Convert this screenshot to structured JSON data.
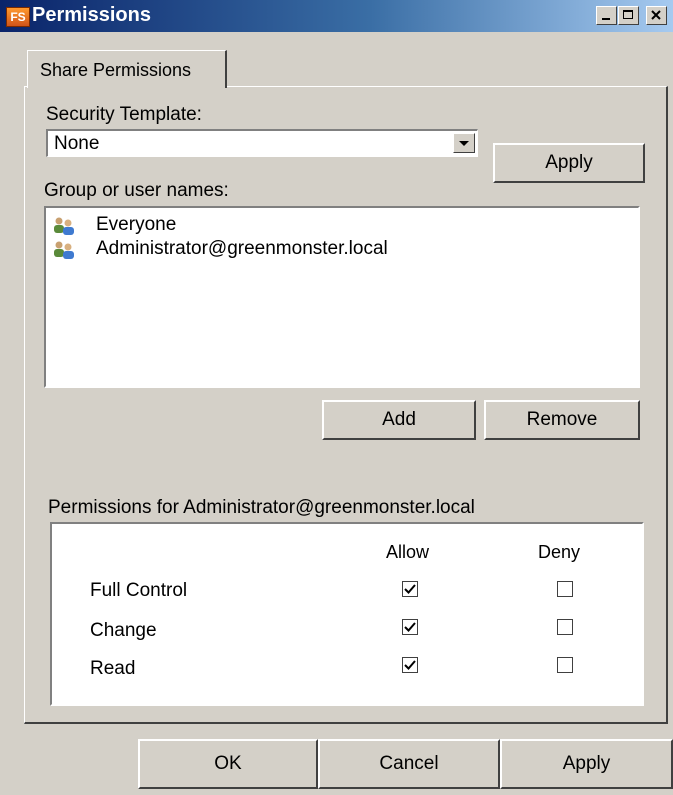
{
  "window": {
    "title": "Permissions",
    "app_icon": "FS"
  },
  "tabs": [
    {
      "label": "Share Permissions",
      "active": true
    }
  ],
  "security_template": {
    "label": "Security Template:",
    "value": "None",
    "apply_label": "Apply"
  },
  "group_list": {
    "label": "Group or user names:",
    "items": [
      {
        "name": "Everyone",
        "icon": "users-icon"
      },
      {
        "name": "Administrator@greenmonster.local",
        "icon": "users-icon"
      }
    ],
    "add_label": "Add",
    "remove_label": "Remove"
  },
  "permissions": {
    "label": "Permissions for Administrator@greenmonster.local",
    "columns": [
      "Allow",
      "Deny"
    ],
    "rows": [
      {
        "name": "Full Control",
        "allow": true,
        "deny": false
      },
      {
        "name": "Change",
        "allow": true,
        "deny": false
      },
      {
        "name": "Read",
        "allow": true,
        "deny": false
      }
    ]
  },
  "footer": {
    "ok_label": "OK",
    "cancel_label": "Cancel",
    "apply_label": "Apply"
  }
}
